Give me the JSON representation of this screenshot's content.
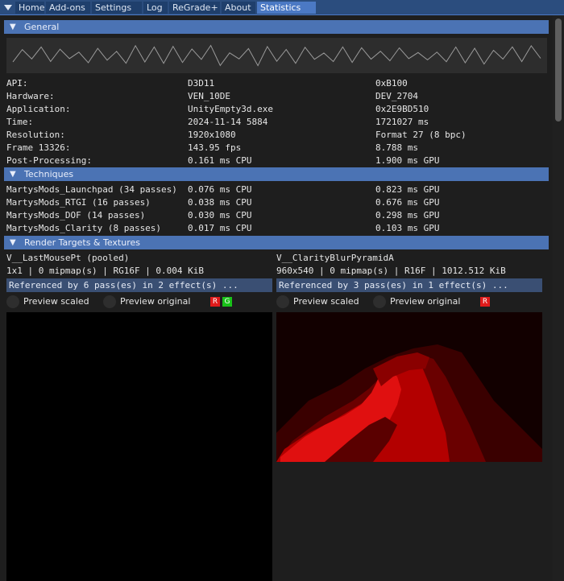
{
  "tabs": [
    {
      "label": "Home"
    },
    {
      "label": "Add-ons"
    },
    {
      "label": "Settings"
    },
    {
      "label": "Log"
    },
    {
      "label": "ReGrade+"
    },
    {
      "label": "About"
    },
    {
      "label": "Statistics"
    }
  ],
  "active_tab": "Statistics",
  "menu_icon": "triangle-down-icon",
  "general": {
    "title": "General",
    "rows": [
      {
        "label": "API:",
        "v1": "D3D11",
        "v2": "0xB100"
      },
      {
        "label": "Hardware:",
        "v1": "VEN_10DE",
        "v2": "DEV_2704"
      },
      {
        "label": "Application:",
        "v1": "UnityEmpty3d.exe",
        "v2": "0x2E9BD510"
      },
      {
        "label": "Time:",
        "v1": "2024-11-14 5884",
        "v2": "1721027 ms"
      },
      {
        "label": "Resolution:",
        "v1": "1920x1080",
        "v2": "Format 27 (8 bpc)"
      },
      {
        "label": "Frame 13326:",
        "v1": "143.95 fps",
        "v2": "8.788 ms"
      },
      {
        "label": "Post-Processing:",
        "v1": "0.161 ms CPU",
        "v2": "1.900 ms GPU"
      }
    ]
  },
  "techniques": {
    "title": "Techniques",
    "rows": [
      {
        "name": "MartysMods_Launchpad (34 passes)",
        "cpu": "0.076 ms CPU",
        "gpu": "0.823 ms GPU"
      },
      {
        "name": "MartysMods_RTGI (16 passes)",
        "cpu": "0.038 ms CPU",
        "gpu": "0.676 ms GPU"
      },
      {
        "name": "MartysMods_DOF (14 passes)",
        "cpu": "0.030 ms CPU",
        "gpu": "0.298 ms GPU"
      },
      {
        "name": "MartysMods_Clarity (8 passes)",
        "cpu": "0.017 ms CPU",
        "gpu": "0.103 ms GPU"
      }
    ]
  },
  "render_targets": {
    "title": "Render Targets & Textures",
    "items": [
      {
        "name": "V__LastMousePt (pooled)",
        "info": "1x1 | 0 mipmap(s) | RG16F | 0.004 KiB",
        "refs": "Referenced by 6 pass(es) in 2 effect(s) ...",
        "preview_scaled": "Preview scaled",
        "preview_original": "Preview original",
        "channels": [
          "R",
          "G"
        ]
      },
      {
        "name": "V__ClarityBlurPyramidA",
        "info": "960x540 | 0 mipmap(s) | R16F | 1012.512 KiB",
        "refs": "Referenced by 3 pass(es) in 1 effect(s) ...",
        "preview_scaled": "Preview scaled",
        "preview_original": "Preview original",
        "channels": [
          "R"
        ]
      }
    ]
  },
  "colors": {
    "tab_active": "#4b79c4",
    "header_bg": "#4b73b4",
    "channel_r": "#e01b1b",
    "channel_g": "#19c219"
  }
}
